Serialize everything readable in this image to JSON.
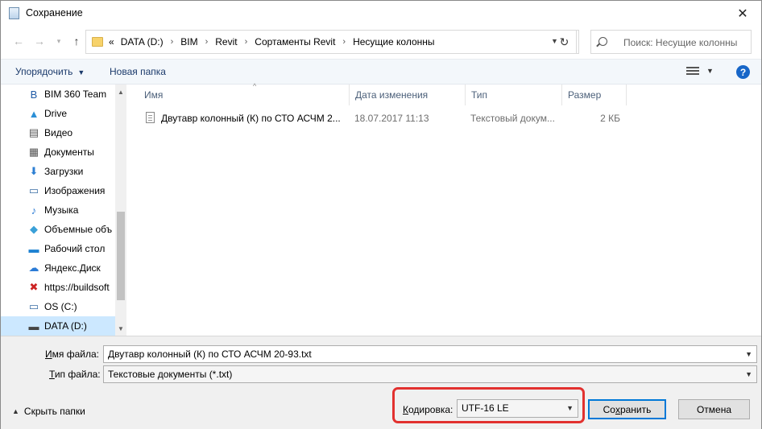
{
  "window": {
    "title": "Сохранение",
    "close_glyph": "✕"
  },
  "nav": {
    "back_glyph": "←",
    "forward_glyph": "→",
    "recent_glyph": "▾",
    "up_glyph": "↑",
    "crumbs_prefix": "«",
    "crumbs": [
      "DATA (D:)",
      "BIM",
      "Revit",
      "Сортаменты Revit",
      "Несущие колонны"
    ],
    "crumb_separator": "›",
    "refresh_glyph": "↻",
    "search_placeholder": "Поиск: Несущие колонны"
  },
  "toolbar": {
    "organize_label": "Упорядочить",
    "new_folder_label": "Новая папка",
    "help_label": "?"
  },
  "sidebar": {
    "items": [
      {
        "label": "BIM 360 Team",
        "icon": "bim360-icon",
        "glyph": "B",
        "color": "#1f5aa6"
      },
      {
        "label": "Drive",
        "icon": "drive-icon",
        "glyph": "▲",
        "color": "#2b8fd6"
      },
      {
        "label": "Видео",
        "icon": "video-icon",
        "glyph": "▤",
        "color": "#555555"
      },
      {
        "label": "Документы",
        "icon": "documents-icon",
        "glyph": "▦",
        "color": "#555555"
      },
      {
        "label": "Загрузки",
        "icon": "downloads-icon",
        "glyph": "⬇",
        "color": "#2d7fd3"
      },
      {
        "label": "Изображения",
        "icon": "pictures-icon",
        "glyph": "▭",
        "color": "#3a6ea5"
      },
      {
        "label": "Музыка",
        "icon": "music-icon",
        "glyph": "♪",
        "color": "#2b7bd6"
      },
      {
        "label": "Объемные объ",
        "icon": "3d-objects-icon",
        "glyph": "◆",
        "color": "#3aa0d8"
      },
      {
        "label": "Рабочий стол",
        "icon": "desktop-icon",
        "glyph": "▬",
        "color": "#1e82d2"
      },
      {
        "label": "Яндекс.Диск",
        "icon": "yandex-disk-icon",
        "glyph": "☁",
        "color": "#2b7bd6"
      },
      {
        "label": "https://buildsoft",
        "icon": "network-drive-error-icon",
        "glyph": "✖",
        "color": "#cc2222"
      },
      {
        "label": "OS (C:)",
        "icon": "drive-c-icon",
        "glyph": "▭",
        "color": "#3a6ea5"
      },
      {
        "label": "DATA (D:)",
        "icon": "drive-d-icon",
        "glyph": "▬",
        "color": "#444444",
        "selected": true
      }
    ]
  },
  "file_list": {
    "columns": [
      "Имя",
      "Дата изменения",
      "Тип",
      "Размер"
    ],
    "sort_glyph": "^",
    "rows": [
      {
        "name": "Двутавр колонный (К) по СТО АСЧМ 2...",
        "date": "18.07.2017 11:13",
        "type": "Текстовый докум...",
        "size": "2 КБ"
      }
    ]
  },
  "form": {
    "filename_label": "Имя файла:",
    "filename_value": "Двутавр колонный (К) по СТО АСЧМ 20-93.txt",
    "filetype_label": "Тип файла:",
    "filetype_value": "Текстовые документы (*.txt)",
    "encoding_label": "Кодировка:",
    "encoding_value": "UTF-16 LE",
    "hide_folders_label": "Скрыть папки",
    "save_label": "Сохранить",
    "cancel_label": "Отмена"
  },
  "colors": {
    "highlight": "#e2312f",
    "selection": "#cce8ff",
    "accent": "#0078d7"
  }
}
